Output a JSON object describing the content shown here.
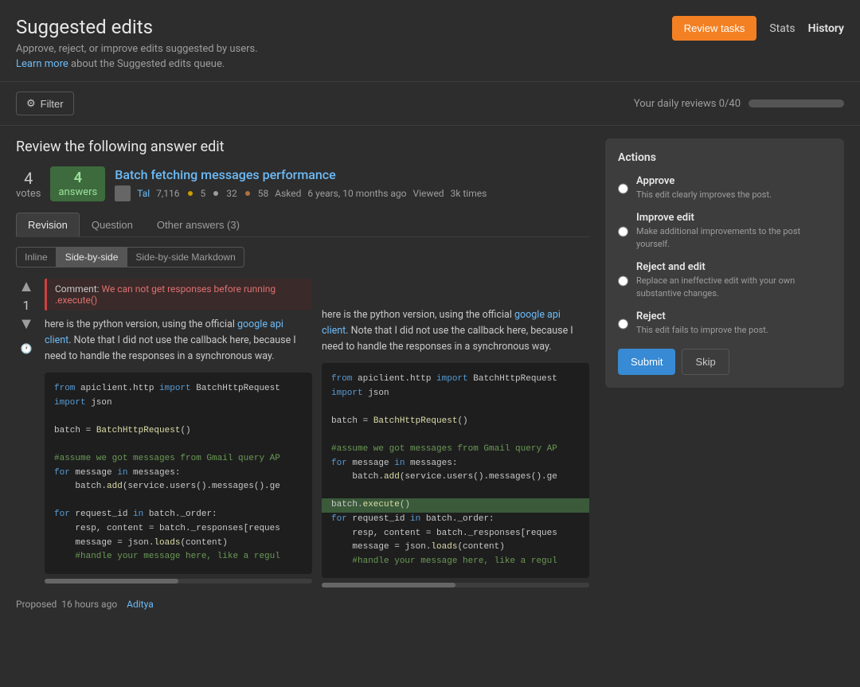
{
  "page": {
    "title": "Suggested edits",
    "description": "Approve, reject, or improve edits suggested by users.",
    "learn_more_text": "Learn more",
    "learn_more_suffix": " about the Suggested edits queue.",
    "nav": {
      "review_tasks_label": "Review tasks",
      "stats_label": "Stats",
      "history_label": "History"
    }
  },
  "filter_bar": {
    "filter_label": "Filter",
    "daily_reviews_label": "Your daily reviews 0/40",
    "progress_value": 0,
    "progress_max": 40
  },
  "review": {
    "heading": "Review the following answer edit",
    "question": {
      "votes": 4,
      "votes_label": "votes",
      "answers": 4,
      "answers_label": "answers",
      "title": "Batch fetching messages performance",
      "author": "Tal",
      "author_rep": "7,116",
      "badges_gold": 5,
      "badges_silver": 32,
      "badges_bronze": 58,
      "asked_label": "Asked",
      "asked_time": "6 years, 10 months ago",
      "viewed_label": "Viewed",
      "viewed_count": "3k times"
    },
    "tabs": [
      {
        "label": "Revision",
        "active": true
      },
      {
        "label": "Question",
        "active": false
      },
      {
        "label": "Other answers (3)",
        "active": false
      }
    ],
    "view_modes": [
      {
        "label": "Inline",
        "active": false
      },
      {
        "label": "Side-by-side",
        "active": true
      },
      {
        "label": "Side-by-side Markdown",
        "active": false
      }
    ],
    "answer_vote": 1,
    "diff_comment": "Comment: We can not get responses before running .execute()",
    "original_text": "here is the python version, using the official",
    "original_link": "google api client",
    "original_text2": ". Note that I did not use the callback here, because I need to handle the responses in a synchronous way.",
    "revised_text": "here is the python version, using the official",
    "revised_link": "google api client",
    "revised_text2": ". Note that I did not use the callback here, because I need to handle the responses in a synchronous way.",
    "original_code": [
      "from apiclient.http import BatchHttpRequest",
      "import json",
      "",
      "batch = BatchHttpRequest()",
      "",
      "#assume we got messages from Gmail query AP",
      "for message in messages:",
      "    batch.add(service.users().messages().ge",
      "",
      "for request_id in batch._order:",
      "    resp, content = batch._responses[reques",
      "    message = json.loads(content)",
      "    #handle your message here, like a regul"
    ],
    "revised_code": [
      "from apiclient.http import BatchHttpRequest",
      "import json",
      "",
      "batch = BatchHttpRequest()",
      "",
      "#assume we got messages from Gmail query AP",
      "for message in messages:",
      "    batch.add(service.users().messages().ge",
      "",
      "batch.execute()",
      "for request_id in batch._order:",
      "    resp, content = batch._responses[reques",
      "    message = json.loads(content)",
      "    #handle your message here, like a regul"
    ],
    "highlighted_line_index": 9,
    "proposed": {
      "label": "Proposed",
      "time": "16 hours ago",
      "author": "Aditya"
    }
  },
  "actions": {
    "title": "Actions",
    "options": [
      {
        "id": "approve",
        "label": "Approve",
        "description": "This edit clearly improves the post."
      },
      {
        "id": "improve-edit",
        "label": "Improve edit",
        "description": "Make additional improvements to the post yourself."
      },
      {
        "id": "reject-and-edit",
        "label": "Reject and edit",
        "description": "Replace an ineffective edit with your own substantive changes."
      },
      {
        "id": "reject",
        "label": "Reject",
        "description": "This edit fails to improve the post."
      }
    ],
    "submit_label": "Submit",
    "skip_label": "Skip"
  }
}
